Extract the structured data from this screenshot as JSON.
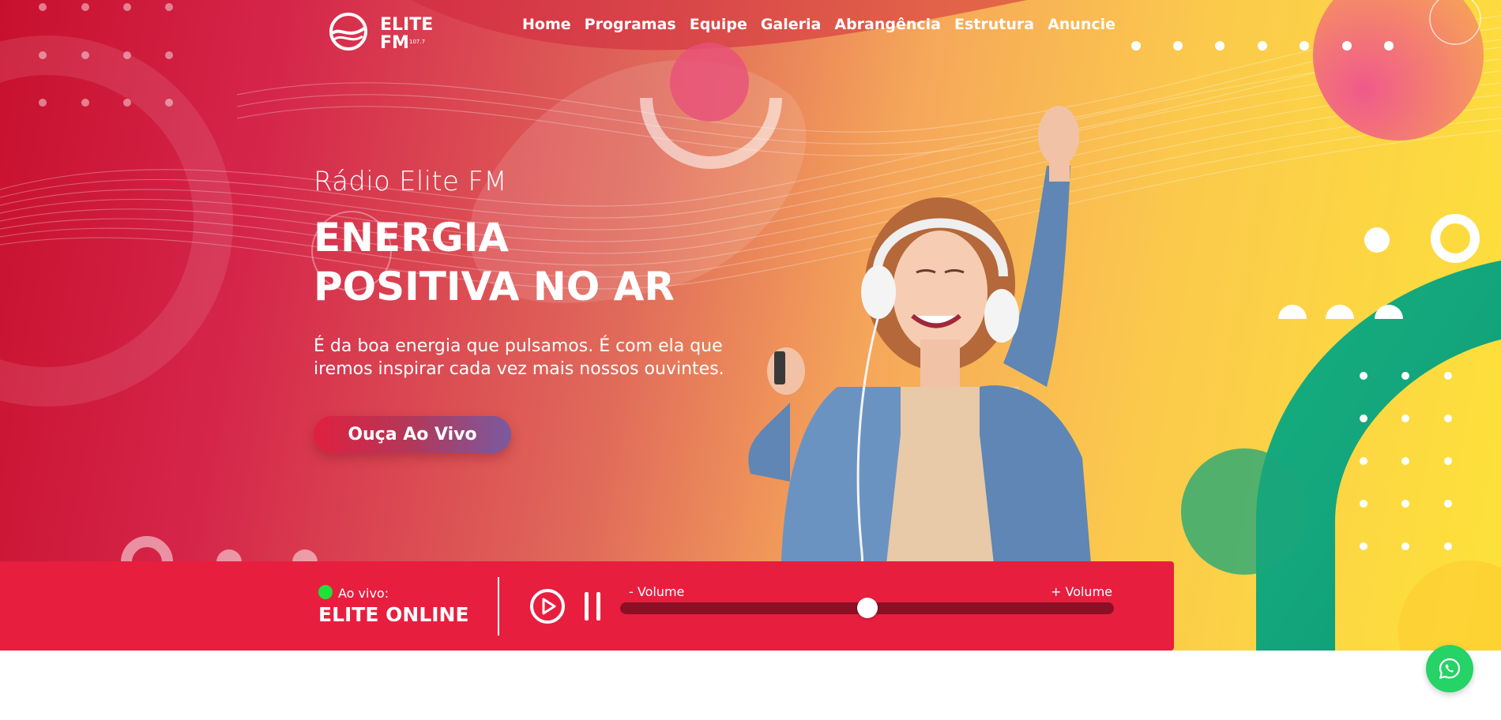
{
  "brand": {
    "logo_line1": "ELITE",
    "logo_line2": "FM",
    "logo_tag": "107.7"
  },
  "nav": {
    "items": [
      {
        "label": "Home"
      },
      {
        "label": "Programas"
      },
      {
        "label": "Equipe"
      },
      {
        "label": "Galeria"
      },
      {
        "label": "Abrangência"
      },
      {
        "label": "Estrutura"
      },
      {
        "label": "Anuncie"
      }
    ]
  },
  "hero": {
    "subtitle": "Rádio Elite FM",
    "headline_line1": "ENERGIA",
    "headline_line2": "POSITIVA NO AR",
    "description_line1": "É da boa energia que pulsamos. É com ela que",
    "description_line2": "iremos inspirar cada vez mais nossos ouvintes.",
    "cta_label": "Ouça Ao Vivo"
  },
  "player": {
    "live_label": "Ao vivo:",
    "station_name": "ELITE ONLINE",
    "volume_min_label": "- Volume",
    "volume_max_label": "+ Volume",
    "volume_level": 0.5,
    "play_icon": "play-circle-icon",
    "pause_icon": "pause-icon"
  },
  "floating": {
    "whatsapp_icon": "whatsapp-icon"
  },
  "colors": {
    "player_bg": "#e81e3f",
    "live_indicator": "#22e03a",
    "whatsapp": "#25d366",
    "accent_green": "#12a77e"
  }
}
